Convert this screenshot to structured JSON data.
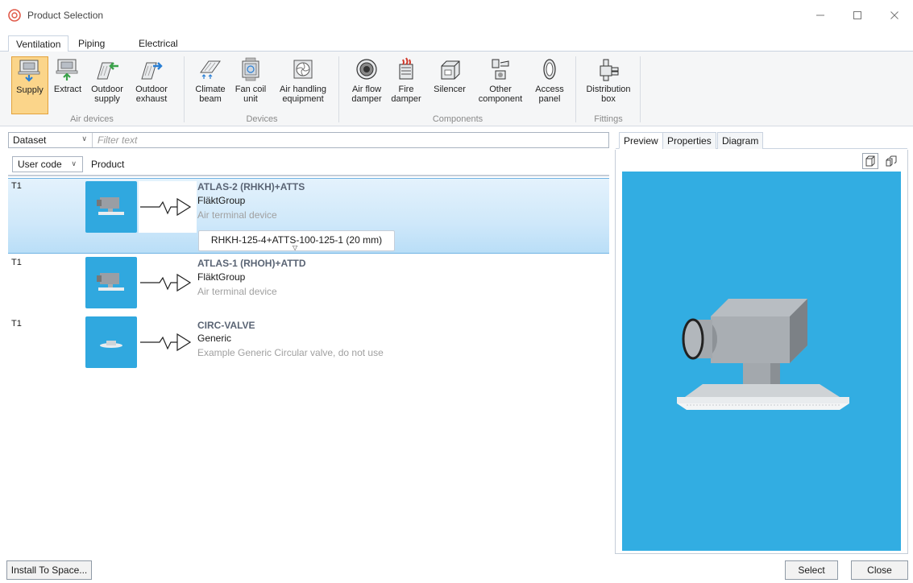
{
  "window": {
    "title": "Product Selection",
    "controls": {
      "minimize": "—",
      "maximize": "☐",
      "close": "✕"
    }
  },
  "ribbon_tabs": [
    {
      "label": "Ventilation",
      "active": true
    },
    {
      "label": "Piping",
      "active": false
    },
    {
      "label": "Electrical",
      "active": false
    }
  ],
  "ribbon": {
    "groups": {
      "air_devices": "Air devices",
      "devices": "Devices",
      "components": "Components",
      "fittings": "Fittings"
    },
    "buttons": {
      "supply": "Supply",
      "extract": "Extract",
      "outdoor_supply": [
        "Outdoor",
        "supply"
      ],
      "outdoor_exhaust": [
        "Outdoor",
        "exhaust"
      ],
      "climate_beam": [
        "Climate",
        "beam"
      ],
      "fan_coil_unit": [
        "Fan coil",
        "unit"
      ],
      "air_handling_equipment": [
        "Air handling",
        "equipment"
      ],
      "air_flow_damper": [
        "Air flow",
        "damper"
      ],
      "fire_damper": [
        "Fire",
        "damper"
      ],
      "silencer": "Silencer",
      "other_component": [
        "Other",
        "component"
      ],
      "access_panel": [
        "Access",
        "panel"
      ],
      "distribution_box": [
        "Distribution",
        "box"
      ]
    },
    "active_button": "Supply"
  },
  "filter": {
    "dataset_label": "Dataset",
    "placeholder": "Filter text"
  },
  "columns": {
    "user_code": "User code",
    "product": "Product"
  },
  "products": [
    {
      "code": "T1",
      "name": "ATLAS-2 (RHKH)+ATTS",
      "manufacturer": "FläktGroup",
      "description": "Air terminal device",
      "selected": true,
      "variant": "RHKH-125-4+ATTS-100-125-1 (20 mm)"
    },
    {
      "code": "T1",
      "name": "ATLAS-1 (RHOH)+ATTD",
      "manufacturer": "FläktGroup",
      "description": "Air terminal device",
      "selected": false
    },
    {
      "code": "T1",
      "name": "CIRC-VALVE",
      "manufacturer": "Generic",
      "description": "Example Generic Circular valve, do not use",
      "selected": false
    }
  ],
  "right_tabs": [
    {
      "label": "Preview",
      "active": true
    },
    {
      "label": "Properties",
      "active": false
    },
    {
      "label": "Diagram",
      "active": false
    }
  ],
  "preview": {
    "background": "#32ade2"
  },
  "footer": {
    "install": "Install To Space...",
    "select": "Select",
    "close": "Close"
  },
  "colors": {
    "accent_active": "#fbd58a",
    "selection": "#cfe8fa",
    "thumb_bg": "#30a8df"
  }
}
